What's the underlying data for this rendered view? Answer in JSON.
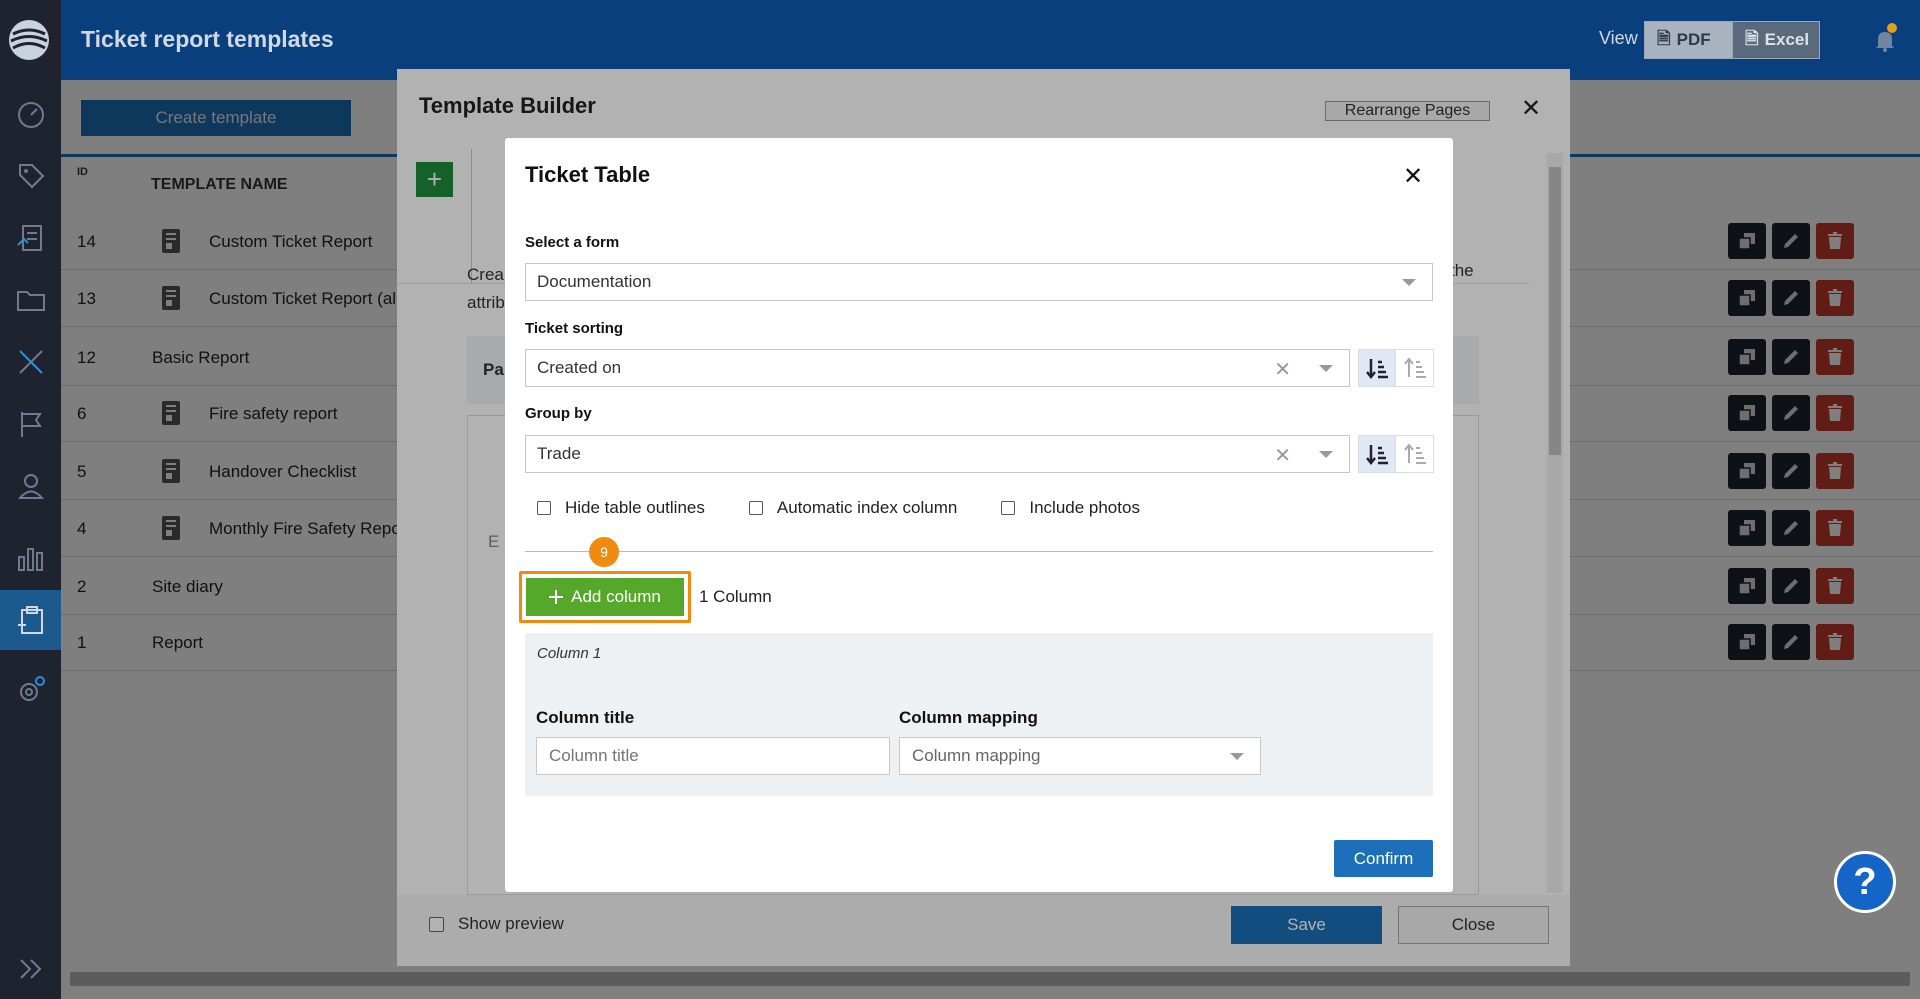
{
  "header": {
    "title": "Ticket report templates",
    "view_label": "View",
    "pdf_label": "PDF",
    "excel_label": "Excel"
  },
  "page": {
    "create_label": "Create template",
    "col_id": "ID",
    "col_name": "TEMPLATE NAME",
    "rows": [
      {
        "id": "14",
        "name": "Custom Ticket Report",
        "has_icon": true
      },
      {
        "id": "13",
        "name": "Custom Ticket Report (al",
        "has_icon": true
      },
      {
        "id": "12",
        "name": "Basic Report",
        "has_icon": false
      },
      {
        "id": "6",
        "name": "Fire safety report",
        "has_icon": true
      },
      {
        "id": "5",
        "name": "Handover Checklist",
        "has_icon": true
      },
      {
        "id": "4",
        "name": "Monthly Fire Safety Repo",
        "has_icon": true
      },
      {
        "id": "2",
        "name": "Site diary",
        "has_icon": false
      },
      {
        "id": "1",
        "name": "Report",
        "has_icon": false
      }
    ]
  },
  "template_builder": {
    "title": "Template Builder",
    "rearrange_label": "Rearrange Pages",
    "desc_line1": "Crea",
    "desc_line2": "attrib",
    "desc_right": "the",
    "page_label": "Pa",
    "inner_e": "E",
    "show_preview_label": "Show preview",
    "save_label": "Save",
    "close_label": "Close"
  },
  "ticket_table": {
    "title": "Ticket Table",
    "form_label": "Select a form",
    "form_value": "Documentation",
    "sorting_label": "Ticket sorting",
    "sorting_value": "Created on",
    "group_label": "Group by",
    "group_value": "Trade",
    "hide_outlines_label": "Hide table outlines",
    "auto_index_label": "Automatic index column",
    "include_photos_label": "Include photos",
    "step_number": "9",
    "add_column_label": "Add column",
    "column_count": "1 Column",
    "column_heading": "Column 1",
    "column_title_label": "Column title",
    "column_title_placeholder": "Column title",
    "column_mapping_label": "Column mapping",
    "column_mapping_placeholder": "Column mapping",
    "confirm_label": "Confirm"
  },
  "help_label": "?",
  "colors": {
    "header_bg": "#0a3f7e",
    "sidebar_bg": "#1f2330",
    "primary": "#1c6fb8",
    "add_green": "#56a82a",
    "highlight_orange": "#f08a11",
    "delete_red": "#c0392b"
  }
}
